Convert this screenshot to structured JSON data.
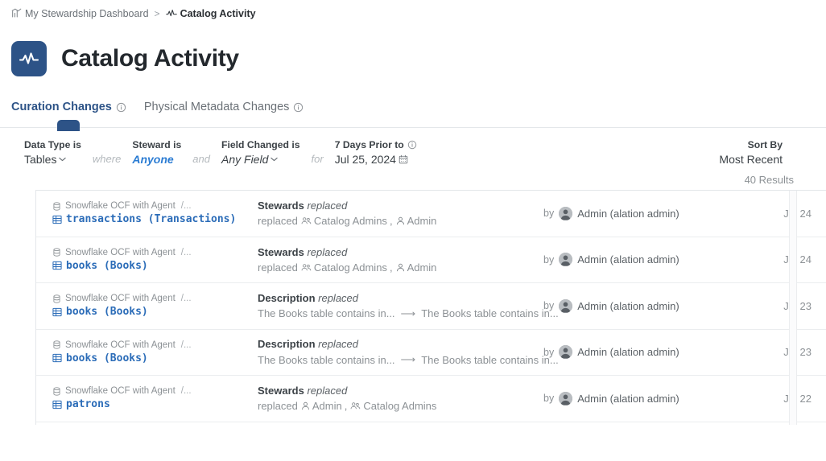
{
  "breadcrumb": {
    "items": [
      {
        "label": "My Stewardship Dashboard",
        "icon": "analytics-icon",
        "current": false
      },
      {
        "label": "Catalog Activity",
        "icon": "activity-pulse-icon",
        "current": true
      }
    ],
    "separator": ">"
  },
  "header": {
    "title": "Catalog Activity",
    "logo_icon": "activity-pulse-icon",
    "logo_color": "#2d5387"
  },
  "tabs": [
    {
      "label": "Curation Changes",
      "active": true,
      "info_icon": "info-circle-icon"
    },
    {
      "label": "Physical Metadata Changes",
      "active": false,
      "info_icon": "info-circle-icon"
    }
  ],
  "filters": {
    "data_type": {
      "label": "Data Type is",
      "value": "Tables",
      "caret": "⌄"
    },
    "conj_where": "where",
    "steward": {
      "label": "Steward is",
      "value": "Anyone"
    },
    "conj_and": "and",
    "field_changed": {
      "label": "Field Changed is",
      "value": "Any Field",
      "caret": "⌄"
    },
    "conj_for": "for",
    "date_range": {
      "label": "7 Days Prior to",
      "value": "Jul 25, 2024",
      "info_icon": "info-circle-icon",
      "calendar_icon": "calendar-icon"
    },
    "sort": {
      "label": "Sort By",
      "value": "Most Recent"
    }
  },
  "results": {
    "count_text": "40 Results"
  },
  "rows": [
    {
      "source": "Snowflake OCF with Agent",
      "path": "/...",
      "source_icon": "database-icon",
      "object_icon": "table-icon",
      "object_name": "transactions (Transactions)",
      "change_field": "Stewards",
      "change_action": "replaced",
      "change_prefix": "replaced",
      "change_items": [
        {
          "icon": "group-icon",
          "label": "Catalog Admins"
        },
        {
          "icon": "person-icon",
          "label": "Admin"
        }
      ],
      "change_old": null,
      "change_new": null,
      "by_label": "by",
      "author": "Admin (alation admin)",
      "avatar_icon": "user-avatar-icon",
      "date": "Jul 24"
    },
    {
      "source": "Snowflake OCF with Agent",
      "path": "/...",
      "source_icon": "database-icon",
      "object_icon": "table-icon",
      "object_name": "books (Books)",
      "change_field": "Stewards",
      "change_action": "replaced",
      "change_prefix": "replaced",
      "change_items": [
        {
          "icon": "group-icon",
          "label": "Catalog Admins"
        },
        {
          "icon": "person-icon",
          "label": "Admin"
        }
      ],
      "change_old": null,
      "change_new": null,
      "by_label": "by",
      "author": "Admin (alation admin)",
      "avatar_icon": "user-avatar-icon",
      "date": "Jul 24"
    },
    {
      "source": "Snowflake OCF with Agent",
      "path": "/...",
      "source_icon": "database-icon",
      "object_icon": "table-icon",
      "object_name": "books (Books)",
      "change_field": "Description",
      "change_action": "replaced",
      "change_prefix": null,
      "change_items": [],
      "change_old": "The Books table contains in...",
      "change_new": "The Books table contains in...",
      "by_label": "by",
      "author": "Admin (alation admin)",
      "avatar_icon": "user-avatar-icon",
      "date": "Jul 23"
    },
    {
      "source": "Snowflake OCF with Agent",
      "path": "/...",
      "source_icon": "database-icon",
      "object_icon": "table-icon",
      "object_name": "books (Books)",
      "change_field": "Description",
      "change_action": "replaced",
      "change_prefix": null,
      "change_items": [],
      "change_old": "The Books table contains in...",
      "change_new": "The Books table contains in...",
      "by_label": "by",
      "author": "Admin (alation admin)",
      "avatar_icon": "user-avatar-icon",
      "date": "Jul 23"
    },
    {
      "source": "Snowflake OCF with Agent",
      "path": "/...",
      "source_icon": "database-icon",
      "object_icon": "table-icon",
      "object_name": "patrons",
      "change_field": "Stewards",
      "change_action": "replaced",
      "change_prefix": "replaced",
      "change_items": [
        {
          "icon": "person-icon",
          "label": "Admin"
        },
        {
          "icon": "group-icon",
          "label": "Catalog Admins"
        }
      ],
      "change_old": null,
      "change_new": null,
      "by_label": "by",
      "author": "Admin (alation admin)",
      "avatar_icon": "user-avatar-icon",
      "date": "Jul 22"
    }
  ],
  "colors": {
    "accent": "#2d5387",
    "link": "#2b7cd3",
    "object_link": "#2b6cb8",
    "muted": "#8c9195",
    "border": "#e4e7ea"
  }
}
